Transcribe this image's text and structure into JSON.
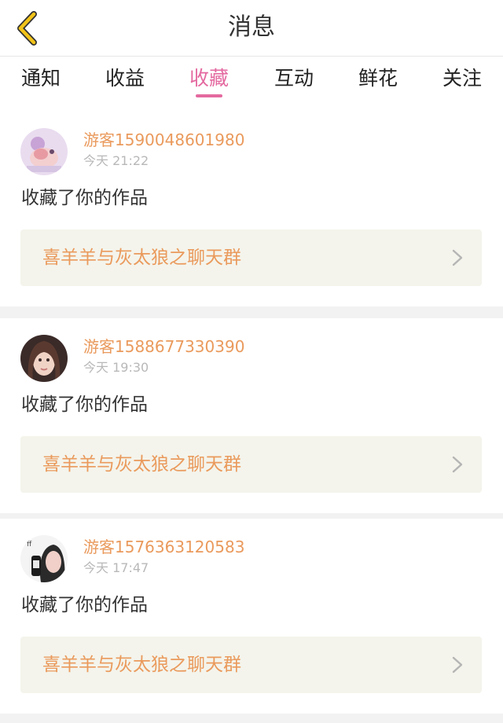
{
  "header": {
    "title": "消息",
    "back_icon": "chevron-left-icon",
    "back_color": "#f2c318"
  },
  "tabs": [
    {
      "label": "通知",
      "active": false
    },
    {
      "label": "收益",
      "active": false
    },
    {
      "label": "收藏",
      "active": true
    },
    {
      "label": "互动",
      "active": false
    },
    {
      "label": "鲜花",
      "active": false
    },
    {
      "label": "关注",
      "active": false
    }
  ],
  "colors": {
    "accent": "#e46aa0",
    "username": "#ea9a5c",
    "link_bg": "#f4f4ec"
  },
  "messages": [
    {
      "username": "游客1590048601980",
      "time": "今天 21:22",
      "action": "收藏了你的作品",
      "work_title": "喜羊羊与灰太狼之聊天群"
    },
    {
      "username": "游客1588677330390",
      "time": "今天 19:30",
      "action": "收藏了你的作品",
      "work_title": "喜羊羊与灰太狼之聊天群"
    },
    {
      "username": "游客1576363120583",
      "time": "今天 17:47",
      "action": "收藏了你的作品",
      "work_title": "喜羊羊与灰太狼之聊天群"
    }
  ]
}
